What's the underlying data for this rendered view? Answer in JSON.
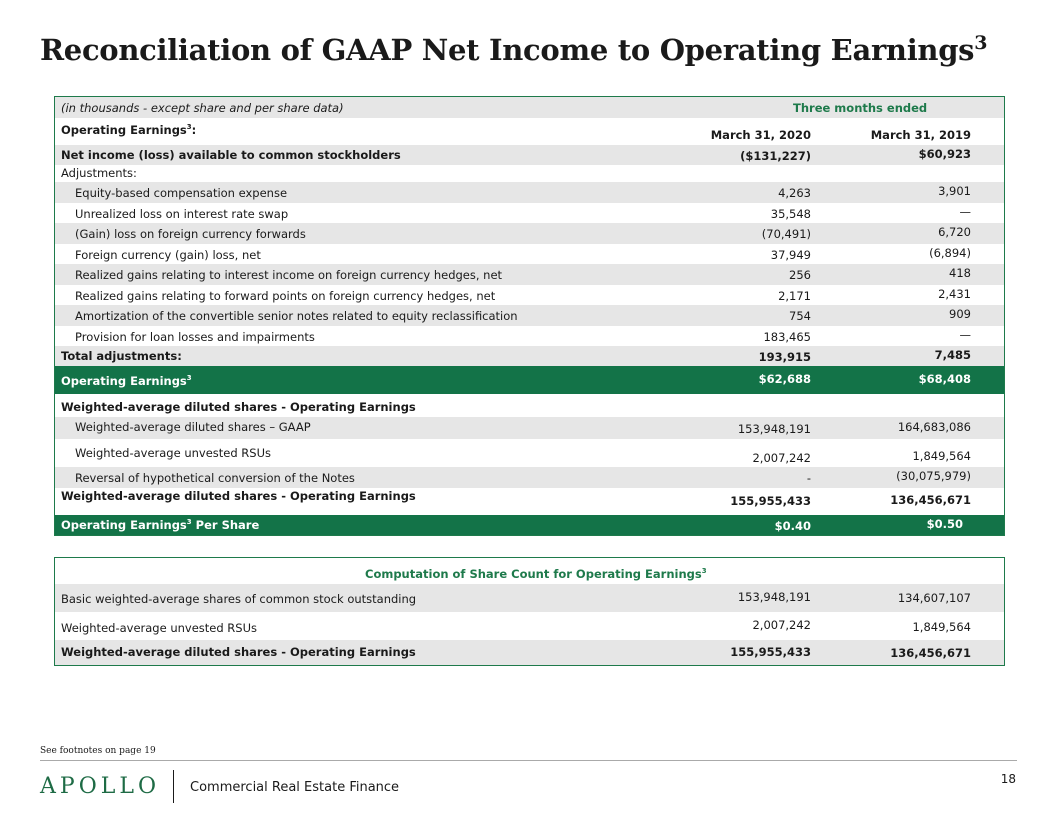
{
  "title": {
    "text": "Reconciliation of  GAAP Net Income to Operating Earnings",
    "sup": "3"
  },
  "table": {
    "note": "(in thousands - except share and per share data)",
    "period_header": "Three months ended",
    "section_label": "Operating Earnings",
    "section_sup": "3",
    "section_colon": ":",
    "col1": "March 31, 2020",
    "col2": "March 31, 2019",
    "net_income": {
      "label": "Net income (loss) available to common stockholders",
      "v1": "($131,227)",
      "v2": "$60,923"
    },
    "adjustments_label": "Adjustments:",
    "adjustments": [
      {
        "label": "Equity-based compensation expense",
        "v1": "4,263",
        "v2": "3,901"
      },
      {
        "label": "Unrealized loss on interest rate swap",
        "v1": "35,548",
        "v2": "—"
      },
      {
        "label": "(Gain) loss on foreign currency forwards",
        "v1": "(70,491)",
        "v2": "6,720"
      },
      {
        "label": "Foreign currency (gain) loss, net",
        "v1": "37,949",
        "v2": "(6,894)"
      },
      {
        "label": "Realized gains relating to interest income on foreign currency hedges, net",
        "v1": "256",
        "v2": "418"
      },
      {
        "label": "Realized gains relating to forward points on foreign currency hedges, net",
        "v1": "2,171",
        "v2": "2,431"
      },
      {
        "label": "Amortization of the convertible senior notes related to equity reclassification",
        "v1": "754",
        "v2": "909"
      },
      {
        "label": "Provision for loan losses and impairments",
        "v1": "183,465",
        "v2": "—"
      }
    ],
    "total_adjustments": {
      "label": "Total adjustments:",
      "v1": "193,915",
      "v2": "7,485"
    },
    "operating_earnings": {
      "label": "Operating Earnings",
      "sup": "3",
      "v1": "$62,688",
      "v2": "$68,408"
    },
    "wads_header": "Weighted-average diluted shares - Operating Earnings",
    "wads_items": [
      {
        "label": "Weighted-average diluted shares – GAAP",
        "v1": "153,948,191",
        "v2": "164,683,086"
      },
      {
        "label": "Weighted-average unvested RSUs",
        "v1": "2,007,242",
        "v2": "1,849,564"
      },
      {
        "label": "Reversal of hypothetical conversion of the Notes",
        "v1": "-",
        "v2": "(30,075,979)"
      }
    ],
    "wads_total": {
      "label": "Weighted-average diluted shares - Operating Earnings",
      "v1": "155,955,433",
      "v2": "136,456,671"
    },
    "per_share": {
      "label": "Operating Earnings",
      "sup": "3",
      "suffix": " Per Share",
      "v1": "$0.40",
      "v2": "$0.50"
    }
  },
  "share_count": {
    "title": "Computation of Share Count for Operating Earnings",
    "title_sup": "3",
    "rows": [
      {
        "label": "Basic weighted-average shares of common stock outstanding",
        "v1": "153,948,191",
        "v2": "134,607,107"
      },
      {
        "label": "Weighted-average unvested RSUs",
        "v1": "2,007,242",
        "v2": "1,849,564"
      }
    ],
    "total": {
      "label": "Weighted-average diluted shares - Operating Earnings",
      "v1": "155,955,433",
      "v2": "136,456,671"
    }
  },
  "footnote": "See footnotes on page 19",
  "footer": {
    "logo": "APOLLO",
    "subtitle": "Commercial Real Estate Finance",
    "page": "18"
  },
  "colors": {
    "brand_green": "#137348",
    "header_green": "#1e7a4b",
    "shade": "#e6e6e6"
  }
}
